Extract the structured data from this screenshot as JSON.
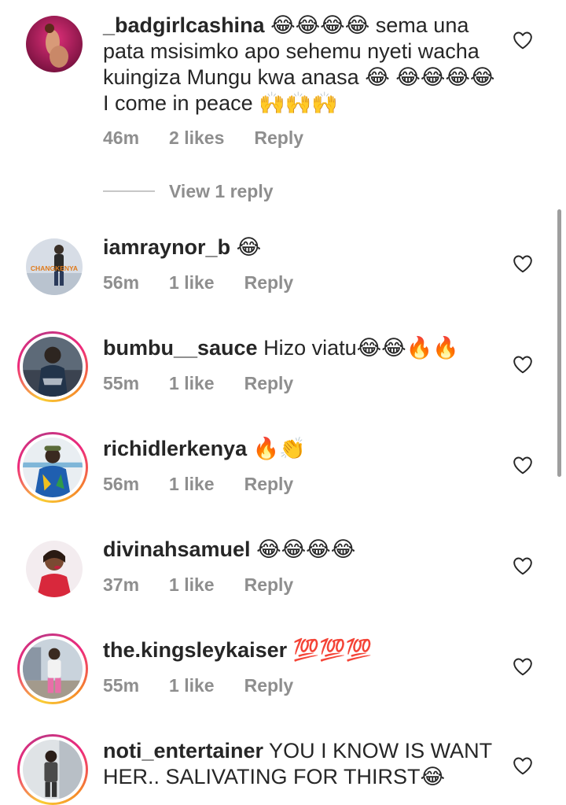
{
  "comments": [
    {
      "username": "_badgirlcashina",
      "text": " 😂😂😂😂 sema una pata msisimko apo sehemu nyeti wacha kuingiza Mungu kwa anasa 😂 😂😂😂😂 I come in peace 🙌🙌🙌",
      "time": "46m",
      "likes": "2 likes",
      "reply": "Reply",
      "view_replies": "View 1 reply"
    },
    {
      "username": "iamraynor_b",
      "text": " 😂",
      "avatar_text": "CHANGKENYA",
      "time": "56m",
      "likes": "1 like",
      "reply": "Reply"
    },
    {
      "username": "bumbu__sauce",
      "text": " Hizo viatu😂😂🔥🔥",
      "time": "55m",
      "likes": "1 like",
      "reply": "Reply"
    },
    {
      "username": "richidlerkenya",
      "text": " 🔥👏",
      "time": "56m",
      "likes": "1 like",
      "reply": "Reply"
    },
    {
      "username": "divinahsamuel",
      "text": " 😂😂😂😂",
      "time": "37m",
      "likes": "1 like",
      "reply": "Reply"
    },
    {
      "username": "the.kingsleykaiser",
      "text": " 💯💯💯",
      "time": "55m",
      "likes": "1 like",
      "reply": "Reply"
    },
    {
      "username": "noti_entertainer",
      "text": " YOU I KNOW IS WANT HER.. SALIVATING FOR THIRST😂"
    }
  ],
  "colors": {
    "text": "#262626",
    "meta": "#8e8e8e",
    "story_ring_start": "#f9ce34",
    "story_ring_mid": "#ee2a7b"
  },
  "icons": {
    "like": "heart-outline-icon"
  }
}
